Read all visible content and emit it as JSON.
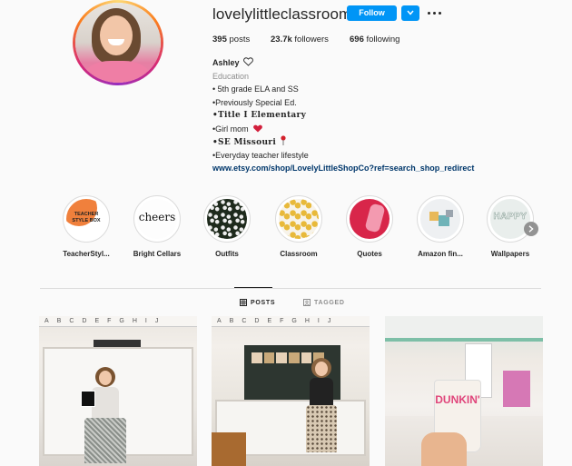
{
  "profile": {
    "username": "lovelylittleclassroom",
    "follow_label": "Follow",
    "stats": {
      "posts_count": "395",
      "posts_label": "posts",
      "followers_count": "23.7k",
      "followers_label": "followers",
      "following_count": "696",
      "following_label": "following"
    },
    "bio": {
      "name": "Ashley",
      "category": "Education",
      "lines": [
        "• 5th grade ELA and SS",
        "•Previously Special Ed.",
        "•Title I Elementary",
        "•Girl mom",
        "•SE Missouri",
        "•Everyday teacher lifestyle"
      ],
      "link": "www.etsy.com/shop/LovelyLittleShopCo?ref=search_shop_redirect"
    }
  },
  "highlights": [
    {
      "label": "TeacherStyl...",
      "cover_text": "TEACHER STYLE BOX"
    },
    {
      "label": "Bright Cellars",
      "cover_text": "cheers"
    },
    {
      "label": "Outfits"
    },
    {
      "label": "Classroom"
    },
    {
      "label": "Quotes"
    },
    {
      "label": "Amazon fin..."
    },
    {
      "label": "Wallpapers",
      "cover_text": "HAPPY"
    }
  ],
  "tabs": {
    "posts_label": "POSTS",
    "tagged_label": "TAGGED"
  },
  "posts": [
    {
      "id": "post-1",
      "cover_text": "ABCDEFGHIJ"
    },
    {
      "id": "post-2",
      "cover_text": "ABCDEFGHIJ"
    },
    {
      "id": "post-3",
      "cover_text": "DUNKIN'"
    }
  ],
  "colors": {
    "accent": "#0095f6",
    "text": "#262626",
    "muted": "#8e8e8e",
    "link": "#00376b",
    "divider": "#dbdbdb"
  },
  "icons": [
    "heart-icon",
    "chevron-down-icon",
    "more-options-icon",
    "grid-icon",
    "tagged-icon",
    "chevron-right-icon",
    "red-heart-emoji",
    "pushpin-emoji"
  ]
}
